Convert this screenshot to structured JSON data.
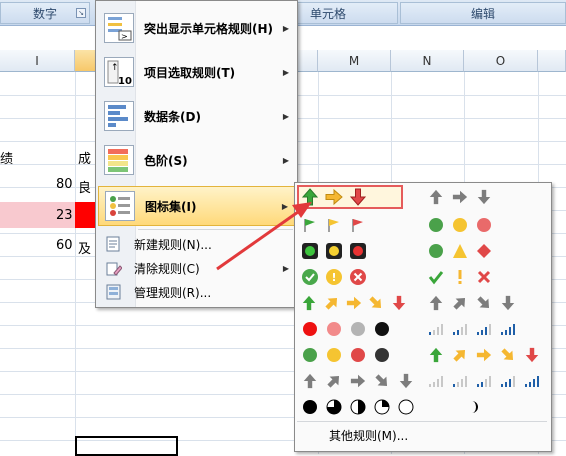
{
  "ribbon": {
    "groups": [
      {
        "label": "数字"
      },
      {
        "label": "单元格"
      },
      {
        "label": "编辑"
      }
    ]
  },
  "sheet": {
    "columns": [
      "I",
      "M",
      "N",
      "O"
    ],
    "cells": {
      "i_header": "绩",
      "j_header": "成",
      "r1_score": "80",
      "r1_grade": "良",
      "r2_score": "23",
      "r3_score": "60",
      "r3_grade": "及"
    }
  },
  "menu": {
    "items": [
      {
        "label": "突出显示单元格规则(H)"
      },
      {
        "label": "项目选取规则(T)"
      },
      {
        "label": "数据条(D)"
      },
      {
        "label": "色阶(S)"
      },
      {
        "label": "图标集(I)"
      },
      {
        "label": "新建规则(N)..."
      },
      {
        "label": "清除规则(C)"
      },
      {
        "label": "管理规则(R)..."
      }
    ]
  },
  "submenu": {
    "more_label": "其他规则(M)..."
  },
  "colors": {
    "highlight_row": "#f8c9cf",
    "red_cell": "#ff0000",
    "annotation_arrow": "#e2393b"
  }
}
